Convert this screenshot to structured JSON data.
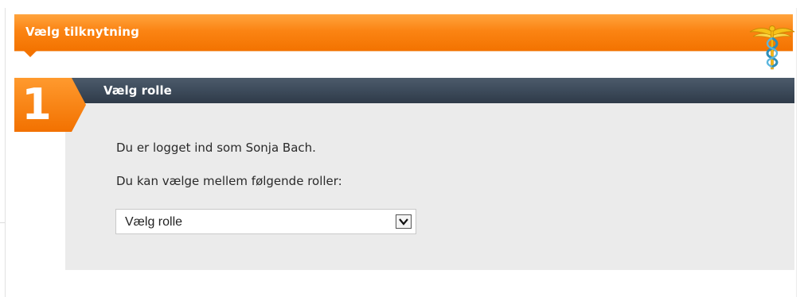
{
  "header": {
    "title": "Vælg tilknytning",
    "icon": "caduceus-icon",
    "accent_color": "#f37300"
  },
  "step": {
    "number": "1",
    "title": "Vælg rolle",
    "bar_color": "#3a4757"
  },
  "content": {
    "logged_in_text": "Du er logget ind som Sonja Bach.",
    "roles_intro_text": "Du kan vælge mellem følgende roller:"
  },
  "role_select": {
    "selected_value": "Vælg rolle",
    "icon": "chevron-down-icon"
  }
}
